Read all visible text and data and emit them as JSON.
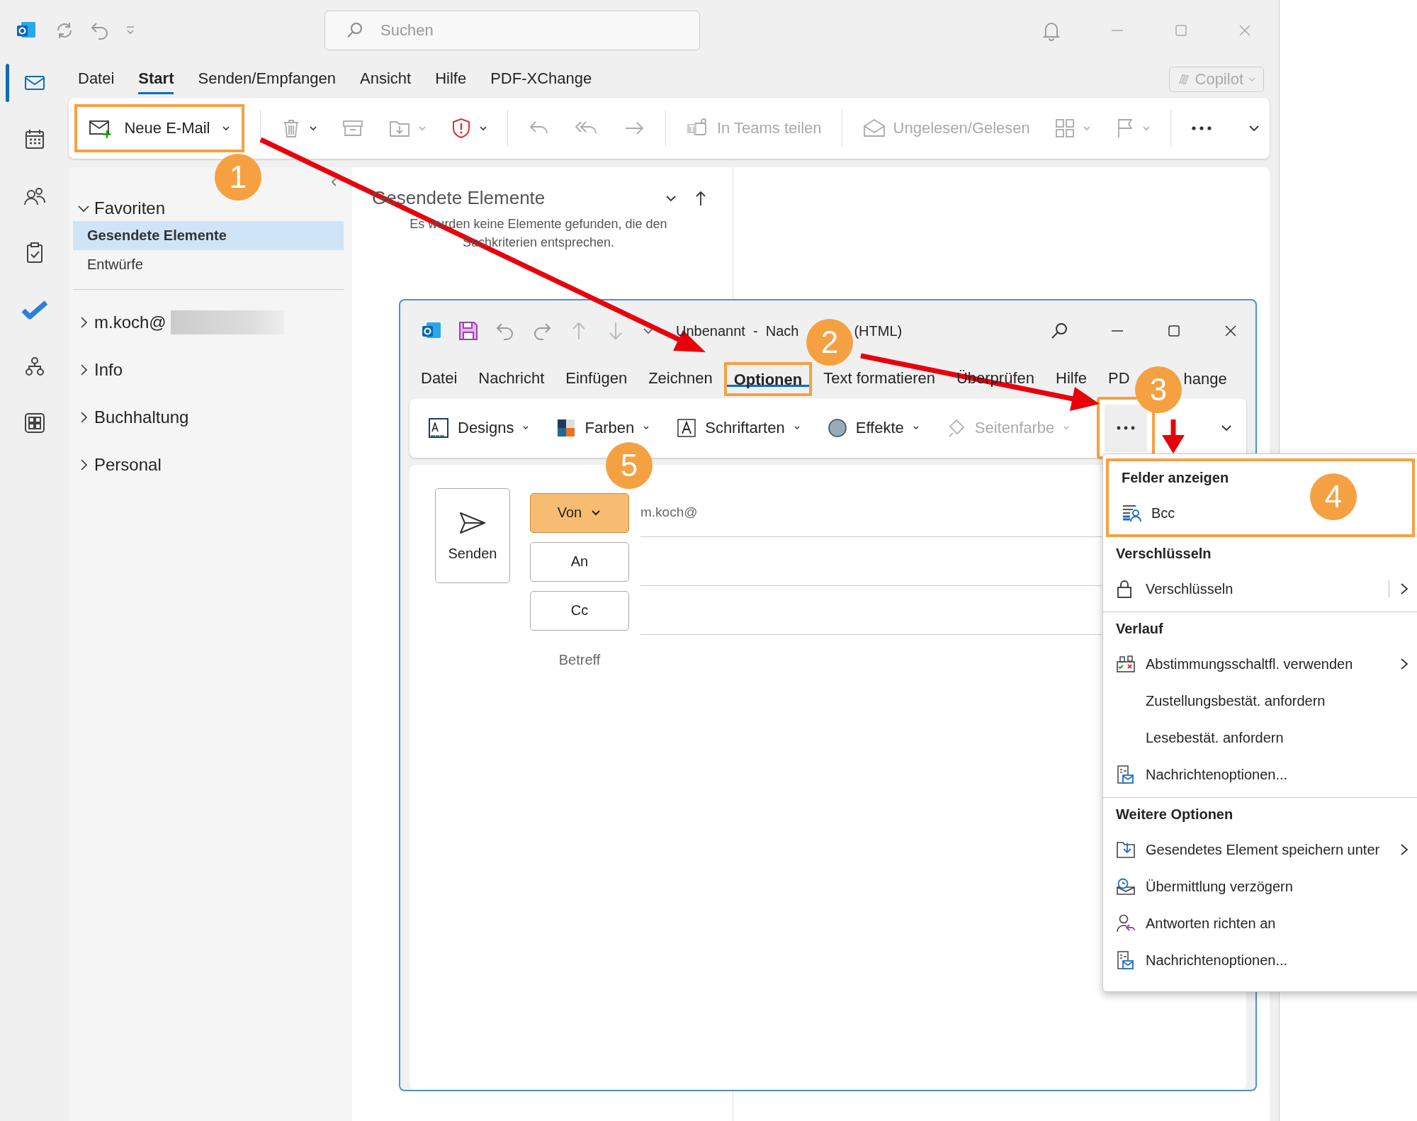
{
  "window": {
    "search": {
      "placeholder": "Suchen"
    },
    "copilot": "Copilot"
  },
  "menu_tabs": [
    {
      "label": "Datei",
      "selected": false
    },
    {
      "label": "Start",
      "selected": true
    },
    {
      "label": "Senden/Empfangen",
      "selected": false
    },
    {
      "label": "Ansicht",
      "selected": false
    },
    {
      "label": "Hilfe",
      "selected": false
    },
    {
      "label": "PDF-XChange",
      "selected": false
    }
  ],
  "ribbon": [
    {
      "kind": "new_mail",
      "label": "Neue E-Mail",
      "disabled": false,
      "highlighted": true
    },
    {
      "kind": "delete",
      "disabled": true
    },
    {
      "kind": "archive",
      "disabled": true
    },
    {
      "kind": "move",
      "disabled": true
    },
    {
      "kind": "report",
      "disabled": false
    },
    {
      "kind": "reply",
      "disabled": true
    },
    {
      "kind": "reply_all",
      "disabled": true
    },
    {
      "kind": "forward",
      "disabled": true
    },
    {
      "kind": "teams",
      "label": "In Teams teilen",
      "disabled": true
    },
    {
      "kind": "read",
      "label": "Ungelesen/Gelesen",
      "disabled": true
    },
    {
      "kind": "view",
      "disabled": true
    },
    {
      "kind": "flag",
      "disabled": true
    },
    {
      "kind": "more"
    }
  ],
  "folders": {
    "favorites": {
      "label": "Favoriten",
      "expanded": true,
      "children": [
        {
          "label": "Gesendete Elemente",
          "selected": true
        },
        {
          "label": "Entwürfe",
          "selected": false
        }
      ]
    },
    "accounts": [
      {
        "label": "m.koch@",
        "expanded": false,
        "redacted": true
      },
      {
        "label": "Info",
        "expanded": false,
        "redacted": false
      },
      {
        "label": "Buchhaltung",
        "expanded": false,
        "redacted": false
      },
      {
        "label": "Personal",
        "expanded": false,
        "redacted": false
      }
    ]
  },
  "message_list": {
    "title": "Gesendete Elemente",
    "empty_text": "Es wurden keine Elemente gefunden, die den Suchkriterien entsprechen."
  },
  "compose": {
    "title": [
      "Unbenannt  -  Nach",
      "(HTML)"
    ],
    "tabs": [
      {
        "label": "Datei",
        "selected": false
      },
      {
        "label": "Nachricht",
        "selected": false
      },
      {
        "label": "Einfügen",
        "selected": false
      },
      {
        "label": "Zeichnen",
        "selected": false
      },
      {
        "label": "Optionen",
        "selected": true,
        "highlighted": true
      },
      {
        "label": "Text formatieren",
        "selected": false
      },
      {
        "label": "Überprüfen",
        "selected": false
      },
      {
        "label": "Hilfe",
        "selected": false
      },
      {
        "label": "PD",
        "label_rest": "hange",
        "selected": false
      }
    ],
    "ribbon": [
      {
        "kind": "designs",
        "label": "Designs",
        "disabled": false
      },
      {
        "kind": "colors",
        "label": "Farben",
        "disabled": false
      },
      {
        "kind": "fonts",
        "label": "Schriftarten",
        "disabled": false
      },
      {
        "kind": "effects",
        "label": "Effekte",
        "disabled": false
      },
      {
        "kind": "page_color",
        "label": "Seitenfarbe",
        "disabled": true
      }
    ],
    "more_highlighted": true,
    "send": "Senden",
    "fields": [
      {
        "kind": "dropdown",
        "label": "Von",
        "value": "m.koch@",
        "highlighted": true
      },
      {
        "kind": "button",
        "label": "An",
        "highlighted": false
      },
      {
        "kind": "button",
        "label": "Cc",
        "highlighted": false
      },
      {
        "kind": "subject",
        "label": "Betreff"
      }
    ]
  },
  "dropdown_menu": {
    "sections": [
      {
        "heading": "Felder anzeigen",
        "highlighted": true,
        "items": [
          {
            "label": "Bcc",
            "submenu": false,
            "split": false
          }
        ]
      },
      {
        "heading": "Verschlüsseln",
        "highlighted": false,
        "items": [
          {
            "label": "Verschlüsseln",
            "submenu": true,
            "split": true
          }
        ]
      },
      {
        "heading": "Verlauf",
        "highlighted": false,
        "items": [
          {
            "label": "Abstimmungsschaltfl. verwenden",
            "submenu": true,
            "split": false
          },
          {
            "label": "Zustellungsbestät. anfordern",
            "submenu": false,
            "split": false
          },
          {
            "label": "Lesebestät. anfordern",
            "submenu": false,
            "split": false
          },
          {
            "label": "Nachrichtenoptionen...",
            "submenu": false,
            "split": false
          }
        ]
      },
      {
        "heading": "Weitere Optionen",
        "highlighted": false,
        "items": [
          {
            "label": "Gesendetes Element speichern unter",
            "submenu": true,
            "split": false
          },
          {
            "label": "Übermittlung verzögern",
            "submenu": false,
            "split": false
          },
          {
            "label": "Antworten richten an",
            "submenu": false,
            "split": false
          },
          {
            "label": "Nachrichtenoptionen...",
            "submenu": false,
            "split": false
          }
        ]
      }
    ]
  },
  "annotations": {
    "badges": [
      "1",
      "2",
      "3",
      "4",
      "5"
    ]
  }
}
